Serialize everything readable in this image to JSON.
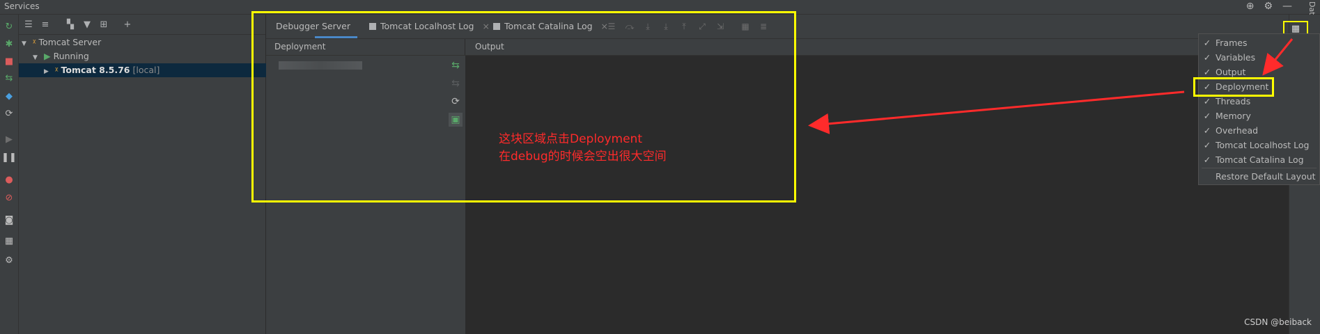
{
  "window": {
    "title": "Services"
  },
  "tree": {
    "items": [
      {
        "label": "Tomcat Server"
      },
      {
        "label": "Running"
      },
      {
        "label": "Tomcat 8.5.76",
        "suffix": "[local]"
      }
    ]
  },
  "tabs": [
    {
      "label": "Debugger"
    },
    {
      "label": "Server"
    },
    {
      "label": "Tomcat Localhost Log"
    },
    {
      "label": "Tomcat Catalina Log"
    }
  ],
  "panes": {
    "deployment_header": "Deployment",
    "output_header": "Output"
  },
  "annotation": {
    "line1": "这块区域点击Deployment",
    "line2": "在debug的时候会空出很大空间"
  },
  "side_label": "Database",
  "menu": {
    "items": [
      {
        "label": "Frames",
        "checked": true
      },
      {
        "label": "Variables",
        "checked": true
      },
      {
        "label": "Output",
        "checked": true
      },
      {
        "label": "Deployment",
        "checked": true
      },
      {
        "label": "Threads",
        "checked": true
      },
      {
        "label": "Memory",
        "checked": true
      },
      {
        "label": "Overhead",
        "checked": true
      },
      {
        "label": "Tomcat Localhost Log",
        "checked": true
      },
      {
        "label": "Tomcat Catalina Log",
        "checked": true
      }
    ],
    "restore": "Restore Default Layout",
    "check_glyph": "✓"
  },
  "watermark": "CSDN @beiback",
  "colors": {
    "highlight": "#ffff00",
    "arrow": "#ff2b2b",
    "selection": "#0d293e",
    "run_green": "#59a869"
  }
}
